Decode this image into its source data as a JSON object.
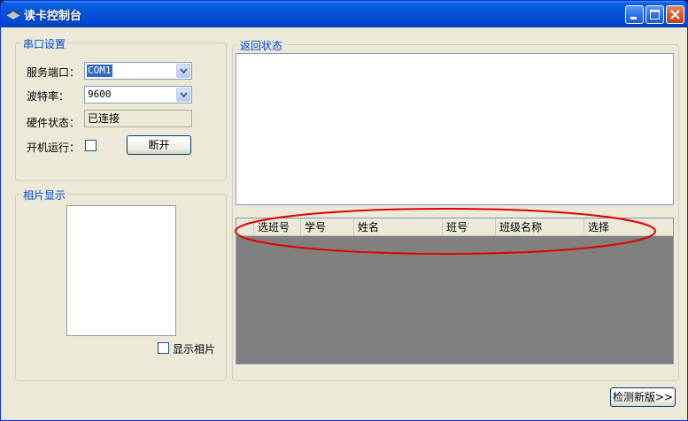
{
  "window": {
    "title": "读卡控制台"
  },
  "serial_group": {
    "legend": "串口设置",
    "port_label": "服务端口：",
    "port_value": "COM1",
    "baud_label": "波特率：",
    "baud_value": "9600",
    "hw_label": "硬件状态：",
    "hw_value": "已连接",
    "autorun_label": "开机运行：",
    "disconnect_label": "断开"
  },
  "photo_group": {
    "legend": "相片显示",
    "show_label": "显示相片"
  },
  "status_group": {
    "legend": "返回状态"
  },
  "table": {
    "columns": [
      "选班号",
      "学号",
      "姓名",
      "班号",
      "班级名称",
      "选择"
    ]
  },
  "footer": {
    "check_update_label": "检测新版>>"
  },
  "colors": {
    "annotation": "#e00000",
    "titlebar": "#0453d9"
  }
}
